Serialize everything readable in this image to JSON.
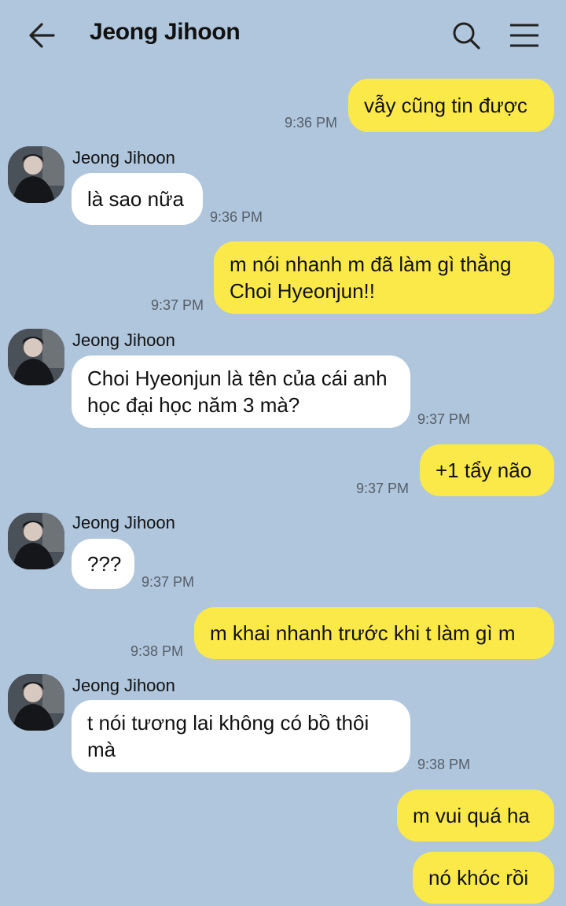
{
  "header": {
    "title": "Jeong Jihoon"
  },
  "messages": [
    {
      "dir": "out",
      "text": "vẫy cũng tin được",
      "time": "9:36 PM"
    },
    {
      "dir": "in",
      "sender": "Jeong Jihoon",
      "text": "là sao nữa",
      "time": "9:36 PM"
    },
    {
      "dir": "out",
      "text": "m nói nhanh m đã làm gì thằng Choi Hyeonjun!!",
      "time": "9:37 PM"
    },
    {
      "dir": "in",
      "sender": "Jeong Jihoon",
      "text": "Choi Hyeonjun là tên của cái anh học đại học năm 3 mà?",
      "time": "9:37 PM"
    },
    {
      "dir": "out",
      "text": "+1 tẩy não",
      "time": "9:37 PM"
    },
    {
      "dir": "in",
      "sender": "Jeong Jihoon",
      "text": "???",
      "time": "9:37 PM"
    },
    {
      "dir": "out",
      "text": "m khai nhanh trước khi t làm gì m",
      "time": "9:38 PM"
    },
    {
      "dir": "in",
      "sender": "Jeong Jihoon",
      "text": "t nói tương lai không có bồ thôi mà",
      "time": "9:38 PM"
    },
    {
      "dir": "out",
      "text": "m vui quá ha",
      "time": ""
    },
    {
      "dir": "out",
      "text": "nó khóc rồi",
      "time": ""
    }
  ],
  "colors": {
    "background": "#b0c6dc",
    "outgoing_bubble": "#fbe94a",
    "incoming_bubble": "#ffffff"
  },
  "icons": {
    "back": "arrow-left-icon",
    "search": "search-icon",
    "menu": "hamburger-menu-icon",
    "avatar": "profile-photo"
  }
}
